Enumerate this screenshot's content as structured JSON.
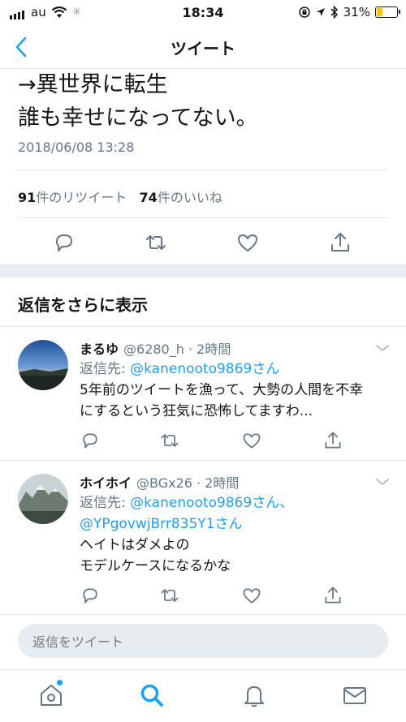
{
  "status": {
    "carrier": "au",
    "time": "18:34",
    "battery": "31%",
    "battery_level": 0.31
  },
  "nav": {
    "title": "ツイート"
  },
  "tweet": {
    "lines": [
      "→異世界に転生",
      "誰も幸せになってない。"
    ],
    "date": "2018/06/08 13:28",
    "retweet_count": "91",
    "retweet_label": "件のリツイート",
    "like_count": "74",
    "like_label": "件のいいね"
  },
  "more_replies_label": "返信をさらに表示",
  "replies": [
    {
      "name": "まるゆ",
      "meta": "@6280_h · 2時間",
      "reply_to_label": "返信先: ",
      "reply_to": "@kanenooto9869さん",
      "text_lines": [
        "5年前のツイートを漁って、大勢の人間を不幸",
        "にするという狂気に恐怖してますわ..."
      ]
    },
    {
      "name": "ホイホイ",
      "meta": "@BGx26 · 2時間",
      "reply_to_label": "返信先: ",
      "reply_to": "@kanenooto9869さん、",
      "reply_to_2": "@YPgovwjBrr835Y1さん",
      "text_lines": [
        "ヘイトはダメよの",
        "モデルケースになるかな"
      ]
    }
  ],
  "compose": {
    "placeholder": "返信をツイート"
  },
  "colors": {
    "accent": "#1da1f2",
    "secondary_text": "#657786",
    "divider": "#e1e8ed"
  },
  "icons": [
    "back-chevron-icon",
    "reply-icon",
    "retweet-icon",
    "like-icon",
    "share-icon",
    "home-icon",
    "search-icon",
    "notifications-icon",
    "messages-icon"
  ]
}
